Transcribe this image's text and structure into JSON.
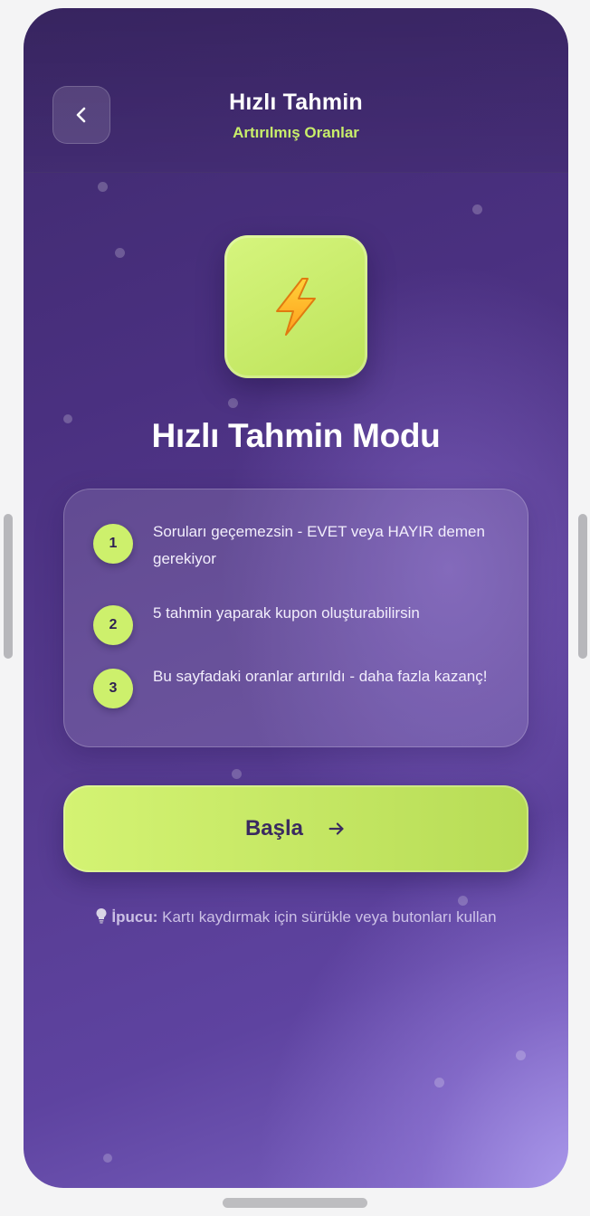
{
  "header": {
    "title": "Hızlı Tahmin",
    "subtitle": "Artırılmış Oranlar",
    "back_icon": "chevron-left-icon"
  },
  "hero": {
    "icon": "lightning-bolt-icon",
    "title": "Hızlı Tahmin Modu"
  },
  "steps": [
    {
      "number": "1",
      "text": "Soruları geçemezsin - EVET veya HAYIR demen gerekiyor"
    },
    {
      "number": "2",
      "text": "5 tahmin yaparak kupon oluşturabilirsin"
    },
    {
      "number": "3",
      "text": "Bu sayfadaki oranlar artırıldı - daha fazla kazanç!"
    }
  ],
  "start_button": {
    "label": "Başla",
    "icon": "arrow-right-icon"
  },
  "tip": {
    "icon": "lightbulb-icon",
    "label": "İpucu:",
    "text": "Kartı kaydırmak için sürükle veya butonları kullan"
  },
  "colors": {
    "accent": "#c8ee6a",
    "background_start": "#3f2a6d",
    "background_end": "#b0a0f0",
    "text_dark": "#3a2a60"
  }
}
